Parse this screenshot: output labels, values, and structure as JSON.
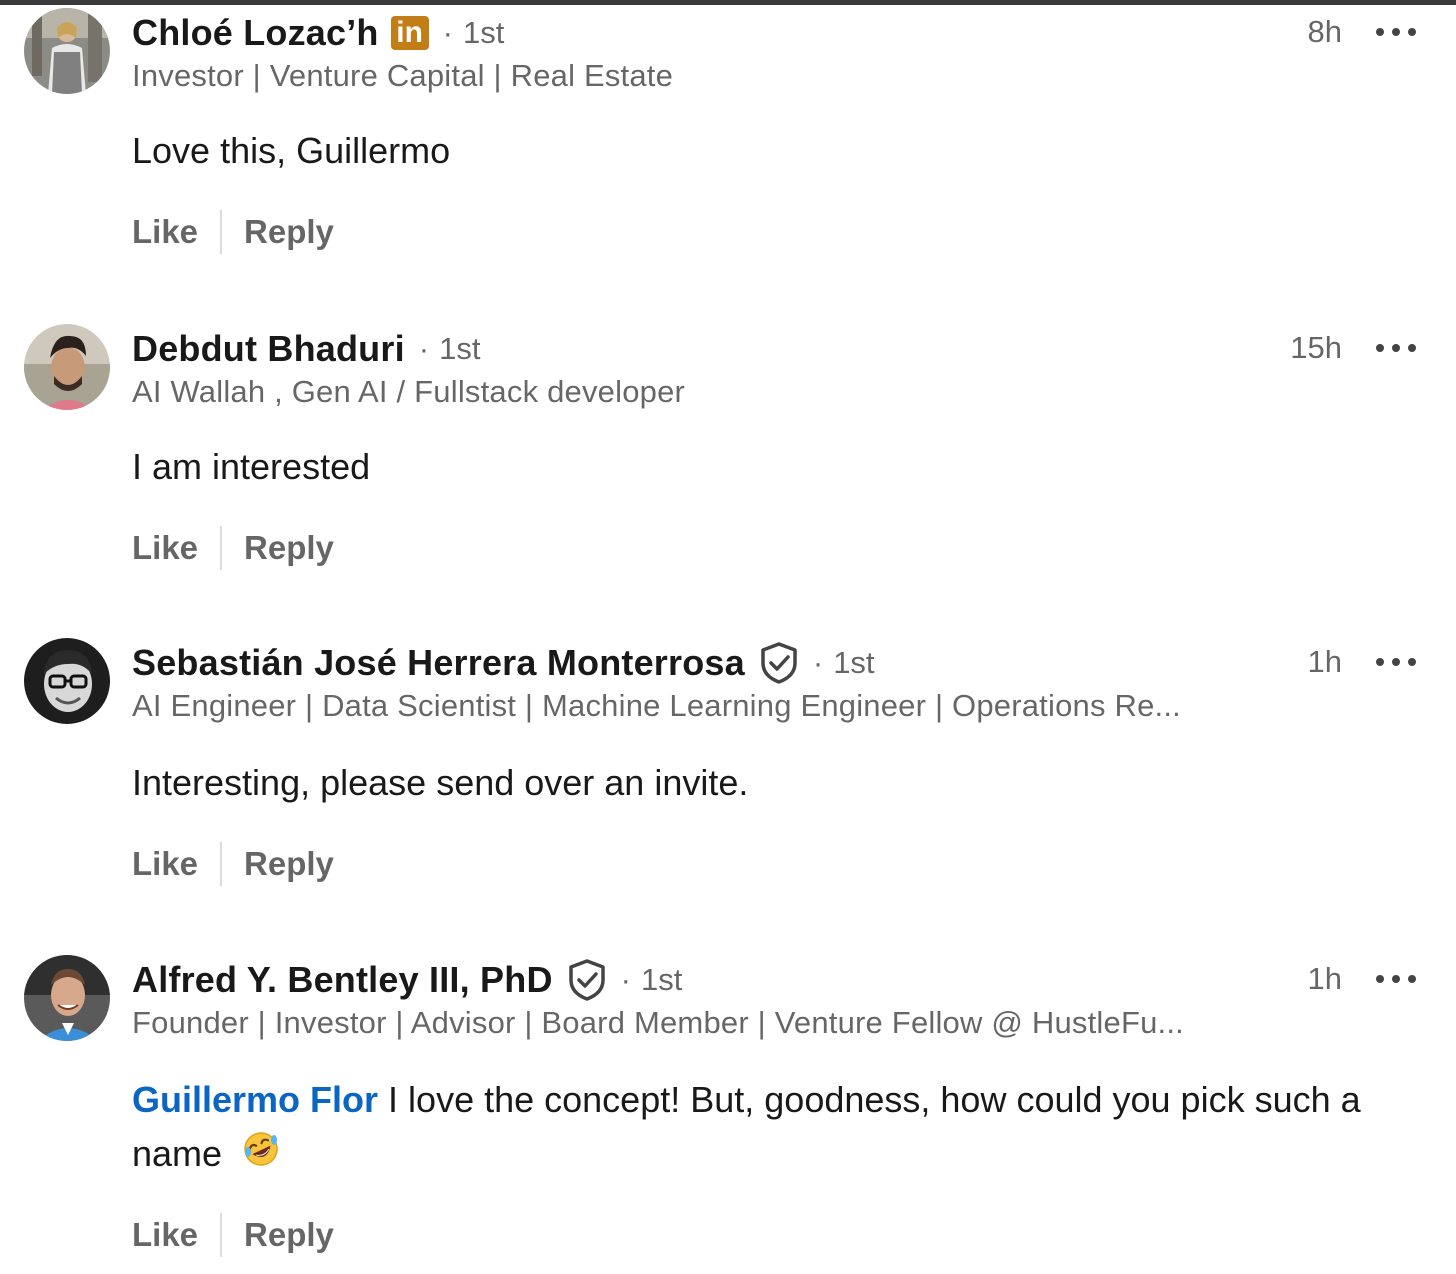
{
  "comments": [
    {
      "name": "Chloé Lozac’h",
      "badge": "in",
      "degree": "1st",
      "headline": "Investor | Venture Capital | Real Estate",
      "time": "8h",
      "text": "Love this, Guillermo",
      "like_label": "Like",
      "reply_label": "Reply"
    },
    {
      "name": "Debdut Bhaduri",
      "degree": "1st",
      "headline": "AI Wallah , Gen AI / Fullstack developer",
      "time": "15h",
      "text": "I am interested",
      "like_label": "Like",
      "reply_label": "Reply"
    },
    {
      "name": "Sebastián José Herrera Monterrosa",
      "degree": "1st",
      "headline": "AI Engineer | Data Scientist | Machine Learning Engineer | Operations Re...",
      "time": "1h",
      "text": "Interesting, please send over an invite.",
      "like_label": "Like",
      "reply_label": "Reply"
    },
    {
      "name": "Alfred Y. Bentley III, PhD",
      "degree": "1st",
      "headline": "Founder | Investor | Advisor | Board Member | Venture Fellow @ HustleFu...",
      "time": "1h",
      "mention": "Guillermo Flor",
      "text": "I love the concept! But, goodness, how could you pick such a name",
      "emoji": "rolling-on-the-floor-laughing",
      "like_label": "Like",
      "reply_label": "Reply"
    }
  ],
  "icons": {
    "more": "ellipsis-icon",
    "verified": "verified-shield-icon",
    "premium": "linkedin-premium-badge-icon"
  },
  "colors": {
    "mention": "#0a66c2",
    "premium_badge": "#c37d16",
    "secondary_text": "#666666"
  }
}
